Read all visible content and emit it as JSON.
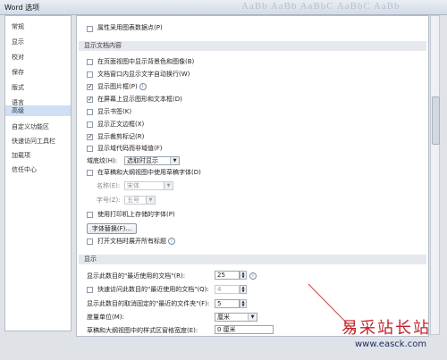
{
  "window": {
    "title": "Word 选项",
    "ghost_text": "AaBb AaBb AaBbC AaBbC AaBb"
  },
  "sidebar": {
    "items": [
      {
        "label": "常规"
      },
      {
        "label": "显示"
      },
      {
        "label": "校对"
      },
      {
        "label": "保存"
      },
      {
        "label": "版式"
      },
      {
        "label": "语言"
      },
      {
        "label": "高级",
        "selected": true
      },
      {
        "label": "自定义功能区"
      },
      {
        "label": "快速访问工具栏"
      },
      {
        "label": "加载项"
      },
      {
        "label": "信任中心"
      }
    ]
  },
  "top_option": {
    "label": "属性采用图表数据点(P)",
    "checked": false
  },
  "doc_content": {
    "header": "显示文档内容",
    "options": [
      {
        "label": "在页面视图中显示背景色和图像(B)",
        "checked": false
      },
      {
        "label": "文档窗口内显示文字自动换行(W)",
        "checked": false
      },
      {
        "label": "显示图片框(P)",
        "checked": true,
        "info": true
      },
      {
        "label": "在屏幕上显示图形和文本框(D)",
        "checked": true
      },
      {
        "label": "显示书签(K)",
        "checked": false
      },
      {
        "label": "显示正文边框(X)",
        "checked": false
      },
      {
        "label": "显示裁剪标记(R)",
        "checked": true
      },
      {
        "label": "显示域代码而非域值(F)",
        "checked": false
      }
    ],
    "field_shading": {
      "label": "域底纹(H):",
      "value": "选取时显示"
    },
    "draft_font": {
      "label": "在草稿和大纲视图中使用草稿字体(D)",
      "checked": false
    },
    "font_name": {
      "label": "名称(E):",
      "value": "宋体"
    },
    "font_size": {
      "label": "字号(Z):",
      "value": "五号"
    },
    "printer_font": {
      "label": "使用打印机上存储的字体(P)",
      "checked": false
    },
    "font_substitution_button": "字体替换(F)...",
    "expand_headings": {
      "label": "打开文档时展开所有标题",
      "checked": false,
      "info": true
    }
  },
  "display": {
    "header": "显示",
    "recent_docs": {
      "label": "显示此数目的\"最近使用的文档\"(R):",
      "value": "25"
    },
    "quick_access": {
      "label": "快速访问此数目的\"最近使用的文档\"(Q):",
      "value": "4",
      "checked": false
    },
    "recent_folders": {
      "label": "显示此数目的取消固定的\"最近的文件夹\"(F):",
      "value": "5"
    },
    "units": {
      "label": "度量单位(M):",
      "value": "厘米"
    },
    "style_width": {
      "label": "草稿和大纲视图中的样式区窗格宽度(E):",
      "value": "0 厘米"
    }
  },
  "watermark": {
    "title": "易采站长站",
    "url": "www.easck.com"
  }
}
